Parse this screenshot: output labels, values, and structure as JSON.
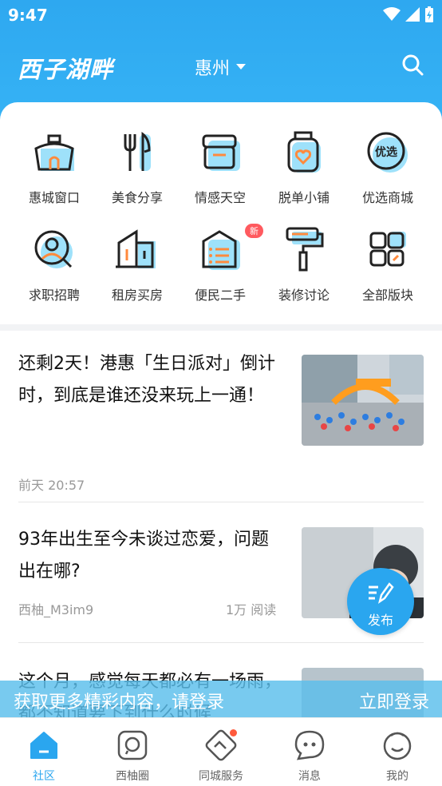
{
  "status": {
    "time": "9:47"
  },
  "header": {
    "logo": "西子湖畔",
    "city": "惠州"
  },
  "categories": [
    {
      "label": "惠城窗口",
      "icon": "house-icon"
    },
    {
      "label": "美食分享",
      "icon": "fork-knife-icon"
    },
    {
      "label": "情感天空",
      "icon": "box-icon"
    },
    {
      "label": "脱单小铺",
      "icon": "heart-jar-icon"
    },
    {
      "label": "优选商城",
      "icon": "youxuan-icon"
    },
    {
      "label": "求职招聘",
      "icon": "search-person-icon"
    },
    {
      "label": "租房买房",
      "icon": "building-icon"
    },
    {
      "label": "便民二手",
      "icon": "list-bag-icon",
      "badge": "新"
    },
    {
      "label": "装修讨论",
      "icon": "paint-roller-icon"
    },
    {
      "label": "全部版块",
      "icon": "grid-icon"
    }
  ],
  "articles": [
    {
      "title": "还剩2天！港惠「生日派对」倒计时，到底是谁还没来玩上一通！",
      "meta": "前天 20:57",
      "reads": ""
    },
    {
      "title": "93年出生至今未谈过恋爱，问题出在哪?",
      "meta": "西柚_M3im9",
      "reads": "1万 阅读"
    },
    {
      "title": "这个月，感觉每天都必有一场雨，都不知道要下到什么时候",
      "meta": "",
      "reads": ""
    }
  ],
  "fab": {
    "label": "发布"
  },
  "login_banner": {
    "message": "获取更多精彩内容，请登录",
    "action": "立即登录"
  },
  "tabs": [
    {
      "label": "社区",
      "icon": "community-icon",
      "active": true
    },
    {
      "label": "西柚圈",
      "icon": "chat-circle-icon"
    },
    {
      "label": "同城服务",
      "icon": "handshake-icon",
      "dot": true
    },
    {
      "label": "消息",
      "icon": "message-icon"
    },
    {
      "label": "我的",
      "icon": "profile-icon"
    }
  ],
  "colors": {
    "primary": "#2aa6ef",
    "badge": "#ff5a5f"
  }
}
